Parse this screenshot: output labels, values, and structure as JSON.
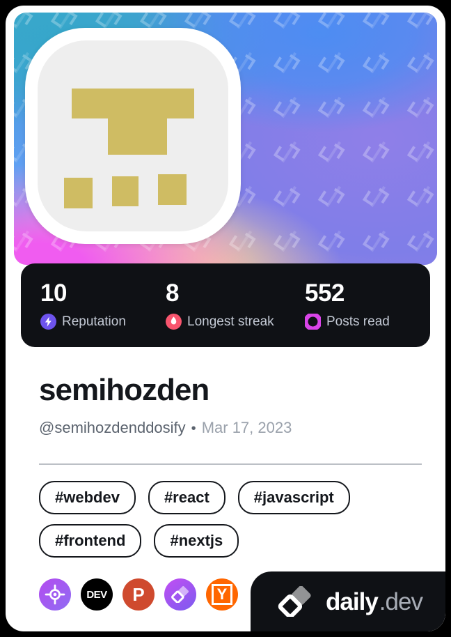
{
  "card": {
    "cover": {
      "alt": "profile-cover-gradient",
      "watermark_icon": "daily-dev-logo-pattern",
      "gradient_colors": [
        "#3fa9cf",
        "#5fa0f2",
        "#f05cf0",
        "#ffd79a",
        "#8d7ae6"
      ]
    },
    "avatar": {
      "alt": "user-avatar",
      "shape": "rounded-square",
      "background_color": "#eeeeee",
      "pixel_color": "#cfbc63"
    },
    "stats": [
      {
        "value": "10",
        "label": "Reputation",
        "icon": "lightning-bolt-icon",
        "icon_color": "#6d53ed"
      },
      {
        "value": "8",
        "label": "Longest streak",
        "icon": "flame-icon",
        "icon_color": "#f8556e"
      },
      {
        "value": "552",
        "label": "Posts read",
        "icon": "ring-icon",
        "icon_color": "#d944e8"
      }
    ],
    "profile": {
      "name": "semihozden",
      "handle": "@semihozdenddosify",
      "separator": "•",
      "joined": "Mar 17, 2023"
    },
    "tags": [
      "#webdev",
      "#react",
      "#javascript",
      "#frontend",
      "#nextjs"
    ],
    "sources": [
      {
        "name": "codepen",
        "icon": "crosshair-icon",
        "label": ""
      },
      {
        "name": "dev-to",
        "icon": "dev-badge-icon",
        "label": "DEV"
      },
      {
        "name": "product-hunt",
        "icon": "product-hunt-icon",
        "label": "P"
      },
      {
        "name": "daily-dev",
        "icon": "daily-dev-logo-icon",
        "label": ""
      },
      {
        "name": "hacker-news",
        "icon": "hacker-news-icon",
        "label": "Y"
      }
    ],
    "badge": {
      "logo_icon": "daily-dev-logo-icon",
      "brand": "daily",
      "brand_suffix": ".dev"
    }
  }
}
